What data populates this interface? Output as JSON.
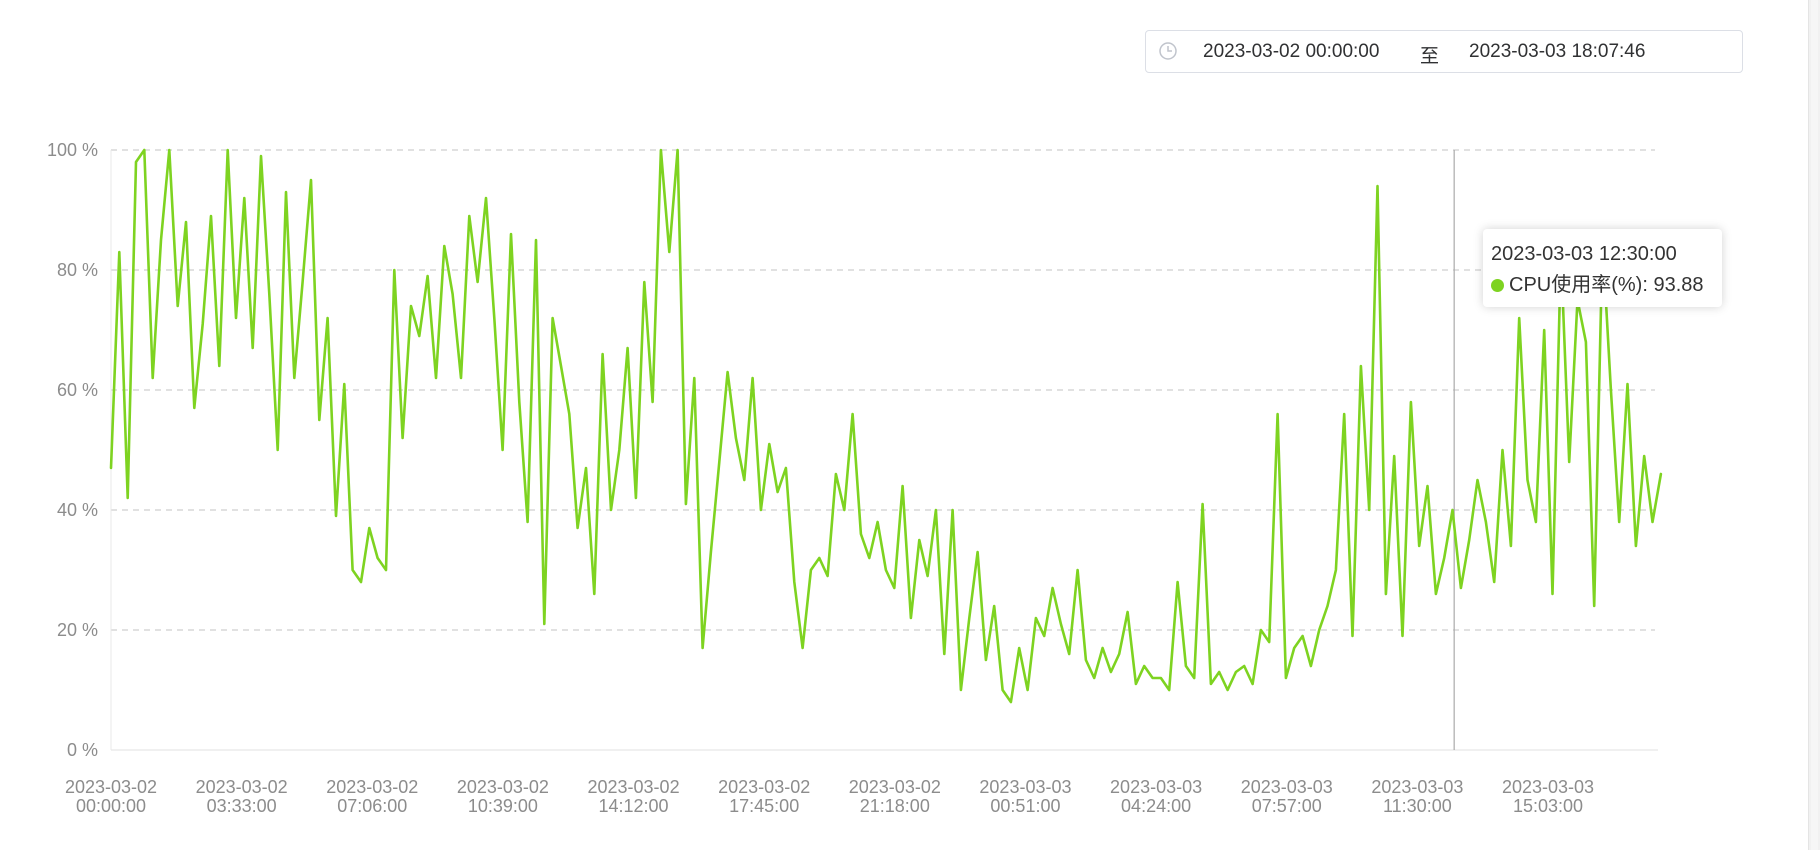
{
  "date_range": {
    "start": "2023-03-02 00:00:00",
    "separator": "至",
    "end": "2023-03-03 18:07:46",
    "icon": "clock-icon"
  },
  "tooltip": {
    "time": "2023-03-03 12:30:00",
    "series_label": "CPU使用率(%): 93.88",
    "dot_color": "#7ed321"
  },
  "chart_data": {
    "type": "line",
    "title": "",
    "xlabel": "",
    "ylabel": "",
    "line_color": "#7ed321",
    "ylim": [
      0,
      100
    ],
    "y_ticks": [
      "0 %",
      "20 %",
      "40 %",
      "60 %",
      "80 %",
      "100 %"
    ],
    "y_tick_values": [
      0,
      20,
      40,
      60,
      80,
      100
    ],
    "x_ticks": [
      {
        "date": "2023-03-02",
        "time": "00:00:00"
      },
      {
        "date": "2023-03-02",
        "time": "03:33:00"
      },
      {
        "date": "2023-03-02",
        "time": "07:06:00"
      },
      {
        "date": "2023-03-02",
        "time": "10:39:00"
      },
      {
        "date": "2023-03-02",
        "time": "14:12:00"
      },
      {
        "date": "2023-03-02",
        "time": "17:45:00"
      },
      {
        "date": "2023-03-02",
        "time": "21:18:00"
      },
      {
        "date": "2023-03-03",
        "time": "00:51:00"
      },
      {
        "date": "2023-03-03",
        "time": "04:24:00"
      },
      {
        "date": "2023-03-03",
        "time": "07:57:00"
      },
      {
        "date": "2023-03-03",
        "time": "11:30:00"
      },
      {
        "date": "2023-03-03",
        "time": "15:03:00"
      }
    ],
    "x_range": [
      "2023-03-02 00:00:00",
      "2023-03-03 18:07:00"
    ],
    "grid": "horizontal dashed",
    "cursor_time": "2023-03-03 12:30:00",
    "series": [
      {
        "name": "CPU使用率(%)",
        "sample_interval_minutes": 60,
        "x_start": "2023-03-02 00:00:00",
        "values": [
          47,
          83,
          42,
          98,
          100,
          62,
          85,
          100,
          74,
          88,
          57,
          71,
          89,
          64,
          100,
          72,
          92,
          67,
          99,
          76,
          50,
          93,
          62,
          78,
          95,
          55,
          72,
          39,
          61,
          30,
          28,
          37,
          32,
          30,
          80,
          52,
          74,
          69,
          79,
          62,
          84,
          76,
          62,
          89,
          78,
          92,
          72,
          50,
          86,
          58,
          38,
          85,
          21,
          72,
          64,
          56,
          37,
          47,
          26,
          66,
          40,
          50,
          67,
          42,
          78,
          58,
          100,
          83,
          100,
          41,
          62,
          17,
          33,
          48,
          63,
          52,
          45,
          62,
          40,
          51,
          43,
          47,
          28,
          17,
          30,
          32,
          29,
          46,
          40,
          56,
          36,
          32,
          38,
          30,
          27,
          44,
          22,
          35,
          29,
          40,
          16,
          40,
          10,
          22,
          33,
          15,
          24,
          10,
          8,
          17,
          10,
          22,
          19,
          27,
          21,
          16,
          30,
          15,
          12,
          17,
          13,
          16,
          23,
          11,
          14,
          12,
          12,
          10,
          28,
          14,
          12,
          41,
          11,
          13,
          10,
          13,
          14,
          11,
          20,
          18,
          56,
          12,
          17,
          19,
          14,
          20,
          24,
          30,
          56,
          19,
          64,
          40,
          94,
          26,
          49,
          19,
          58,
          34,
          44,
          26,
          32,
          40,
          27,
          35,
          45,
          38,
          28,
          50,
          34,
          72,
          45,
          38,
          70,
          26,
          83,
          48,
          75,
          68,
          24,
          85,
          60,
          38,
          61,
          34,
          49,
          38,
          46
        ]
      }
    ]
  }
}
